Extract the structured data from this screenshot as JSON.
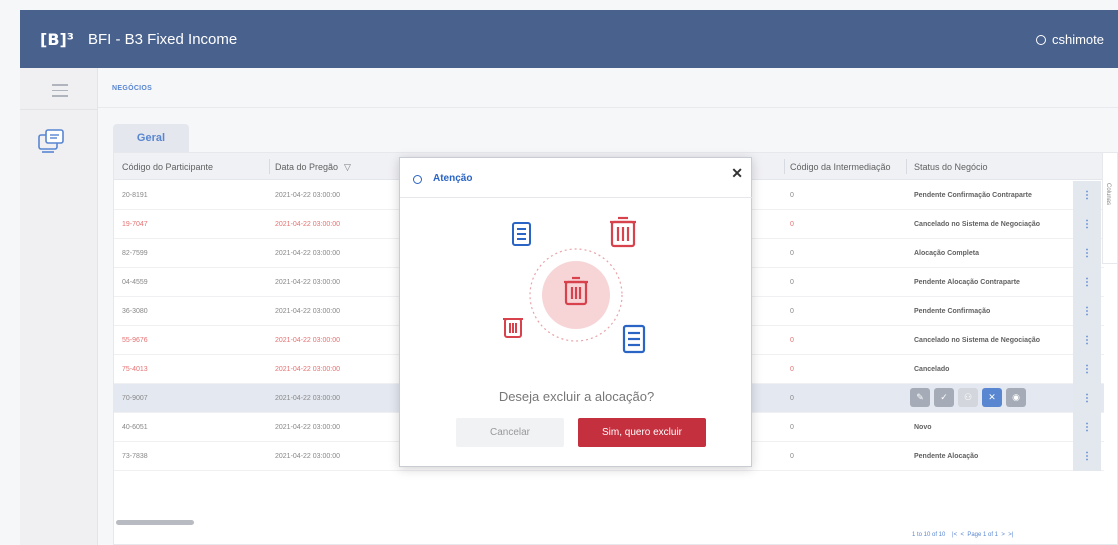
{
  "header": {
    "logo": "[B]³",
    "app_title": "BFI - B3 Fixed Income",
    "user": "cshimote"
  },
  "breadcrumb": "NEGÓCIOS",
  "tabs": [
    {
      "label": "Geral"
    }
  ],
  "grid": {
    "columns": [
      "Código do Participante",
      "Data do Pregão",
      "Código da Intermediação",
      "Status do Negócio"
    ],
    "rows": [
      {
        "participante": "20-8191",
        "data": "2021-04-22 03:00:00",
        "intermediacao": "0",
        "status": "Pendente Confirmação Contraparte",
        "red": false
      },
      {
        "participante": "19-7047",
        "data": "2021-04-22 03:00:00",
        "intermediacao": "0",
        "status": "Cancelado no Sistema de Negociação",
        "red": true
      },
      {
        "participante": "82-7599",
        "data": "2021-04-22 03:00:00",
        "intermediacao": "0",
        "status": "Alocação Completa",
        "red": false
      },
      {
        "participante": "04-4559",
        "data": "2021-04-22 03:00:00",
        "intermediacao": "0",
        "status": "Pendente Alocação Contraparte",
        "red": false
      },
      {
        "participante": "36-3080",
        "data": "2021-04-22 03:00:00",
        "intermediacao": "0",
        "status": "Pendente Confirmação",
        "red": false
      },
      {
        "participante": "55-9676",
        "data": "2021-04-22 03:00:00",
        "intermediacao": "0",
        "status": "Cancelado no Sistema de Negociação",
        "red": true
      },
      {
        "participante": "75-4013",
        "data": "2021-04-22 03:00:00",
        "intermediacao": "0",
        "status": "Cancelado",
        "red": true
      },
      {
        "participante": "70-9007",
        "data": "2021-04-22 03:00:00",
        "intermediacao": "0",
        "status": "",
        "red": false
      },
      {
        "participante": "40-6051",
        "data": "2021-04-22 03:00:00",
        "intermediacao": "0",
        "status": "Novo",
        "red": false
      },
      {
        "participante": "73-7838",
        "data": "2021-04-22 03:00:00",
        "intermediacao": "0",
        "status": "Pendente Alocação",
        "red": false
      }
    ],
    "side_label": "Colunas",
    "pagination": {
      "range": "1 to 10 of 10",
      "page": "Page 1 of 1"
    }
  },
  "modal": {
    "title": "Atenção",
    "question": "Deseja excluir a alocação?",
    "cancel_label": "Cancelar",
    "confirm_label": "Sim, quero excluir"
  },
  "colors": {
    "primary": "#16356d",
    "accent": "#2a64c4",
    "danger": "#c4303e",
    "alert_red": "#e0484a"
  }
}
